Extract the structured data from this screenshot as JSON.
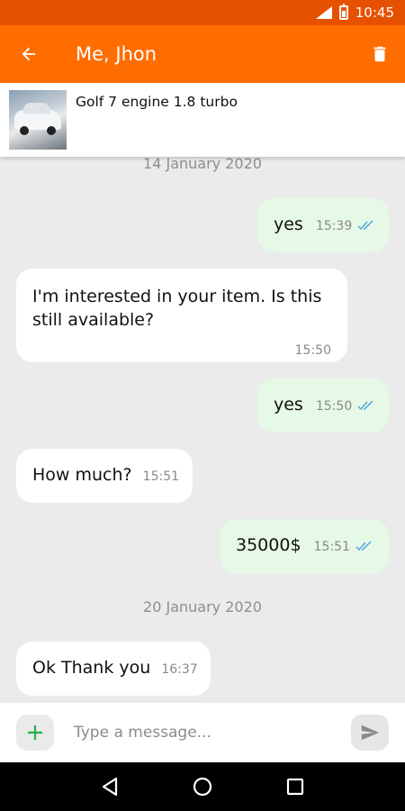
{
  "status_bar": {
    "network": "LTE",
    "time": "10:45"
  },
  "app_bar": {
    "title": "Me, Jhon",
    "back_icon": "arrow-left-icon",
    "delete_icon": "trash-icon"
  },
  "listing": {
    "title": "Golf 7 engine 1.8 turbo"
  },
  "chat": {
    "date1": "14 January 2020",
    "date2": "20 January 2020",
    "messages": [
      {
        "direction": "out",
        "text": "yes",
        "time": "15:39",
        "read": true
      },
      {
        "direction": "in",
        "text": "I'm interested in your item. Is this still available?",
        "time": "15:50"
      },
      {
        "direction": "out",
        "text": "yes",
        "time": "15:50",
        "read": true
      },
      {
        "direction": "in",
        "text": "How much?",
        "time": "15:51"
      },
      {
        "direction": "out",
        "text": "35000$",
        "time": "15:51",
        "read": true
      },
      {
        "direction": "in",
        "text": "Ok Thank you",
        "time": "16:37"
      }
    ]
  },
  "input": {
    "placeholder": "Type a message..."
  },
  "colors": {
    "status_bar": "#e65100",
    "app_bar": "#ff6d00",
    "outgoing_bubble": "#e6f8e6",
    "incoming_bubble": "#ffffff",
    "tick": "#4aa3df",
    "plus": "#22b04b"
  }
}
